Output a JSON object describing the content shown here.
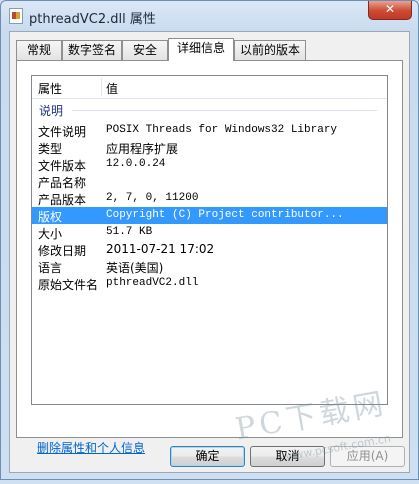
{
  "window": {
    "title": "pthreadVC2.dll 属性",
    "close_glyph": "✕"
  },
  "tabs": [
    {
      "label": "常规",
      "active": false
    },
    {
      "label": "数字签名",
      "active": false
    },
    {
      "label": "安全",
      "active": false
    },
    {
      "label": "详细信息",
      "active": true
    },
    {
      "label": "以前的版本",
      "active": false
    }
  ],
  "details": {
    "columns": {
      "name": "属性",
      "value": "值"
    },
    "group": "说明",
    "rows": [
      {
        "name": "文件说明",
        "value": "POSIX Threads for Windows32 Library"
      },
      {
        "name": "类型",
        "value": "应用程序扩展"
      },
      {
        "name": "文件版本",
        "value": "12.0.0.24"
      },
      {
        "name": "产品名称",
        "value": ""
      },
      {
        "name": "产品版本",
        "value": "2, 7, 0, 11200"
      },
      {
        "name": "版权",
        "value": "Copyright (C) Project contributor...",
        "selected": true
      },
      {
        "name": "大小",
        "value": "51.7 KB"
      },
      {
        "name": "修改日期",
        "value": "2011-07-21 17:02"
      },
      {
        "name": "语言",
        "value": "英语(美国)"
      },
      {
        "name": "原始文件名",
        "value": "pthreadVC2.dll"
      }
    ]
  },
  "delete_link": "删除属性和个人信息",
  "buttons": {
    "ok": "确定",
    "cancel": "取消",
    "apply": "应用(A)"
  },
  "watermark": {
    "brand": "PC下载网",
    "url": "www.pcsoft.com.cn"
  },
  "colors": {
    "selection": "#3399ff",
    "link": "#0066cc",
    "close_button": "#c0392a"
  }
}
